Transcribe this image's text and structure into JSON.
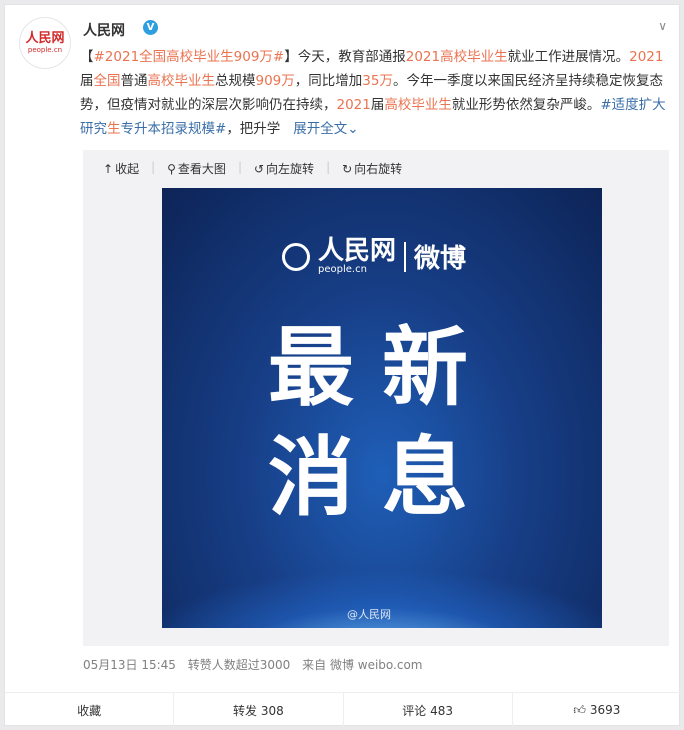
{
  "author": {
    "name": "人民网",
    "logo_text": "人民网",
    "logo_sub": "people.cn"
  },
  "post": {
    "seg1": "【",
    "hashtag1": "#2021全国高校毕业生909万#",
    "seg2": "】今天，教育部通报",
    "hl1": "2021高校毕业生",
    "seg3": "就业工作进展情况。",
    "hl2": "2021",
    "seg4": "届",
    "hl3": "全国",
    "seg5": "普通",
    "hl4": "高校毕业生",
    "seg6": "总规模",
    "hl5": "909万",
    "seg7": "，同比增加",
    "hl6": "35万",
    "seg8": "。今年一季度以来国民经济呈持续稳定恢复态势，但疫情对就业的深层次影响仍在持续，",
    "hl7": "2021",
    "seg9": "届",
    "hl8": "高校毕业生",
    "seg10": "就业形势依然复杂严峻。",
    "hashtag2a": "#适度扩大研究",
    "hashtag2b": "生",
    "hashtag2c": "专升本招录规模#",
    "seg11": "，把升学",
    "expand": "展开全文"
  },
  "media": {
    "toolbar": {
      "collapse": "收起",
      "view_large": "查看大图",
      "rotate_left": "向左旋转",
      "rotate_right": "向右旋转"
    },
    "image": {
      "brand_name": "人民网",
      "brand_url": "people.cn",
      "brand_weibo": "微博",
      "line1": "最新",
      "line2": "消息",
      "watermark": "@人民网"
    }
  },
  "meta": {
    "date": "05月13日 15:45",
    "reposts_note": "转赞人数超过3000",
    "source": "来自 微博 weibo.com"
  },
  "actions": {
    "favorite": "收藏",
    "repost": "转发 308",
    "comment": "评论 483",
    "like": "3693"
  },
  "colors": {
    "highlight": "#eb7350",
    "link_blue": "#3a6ea8",
    "verified_badge": "#2d9ee0",
    "logo_red": "#d32b2b"
  }
}
